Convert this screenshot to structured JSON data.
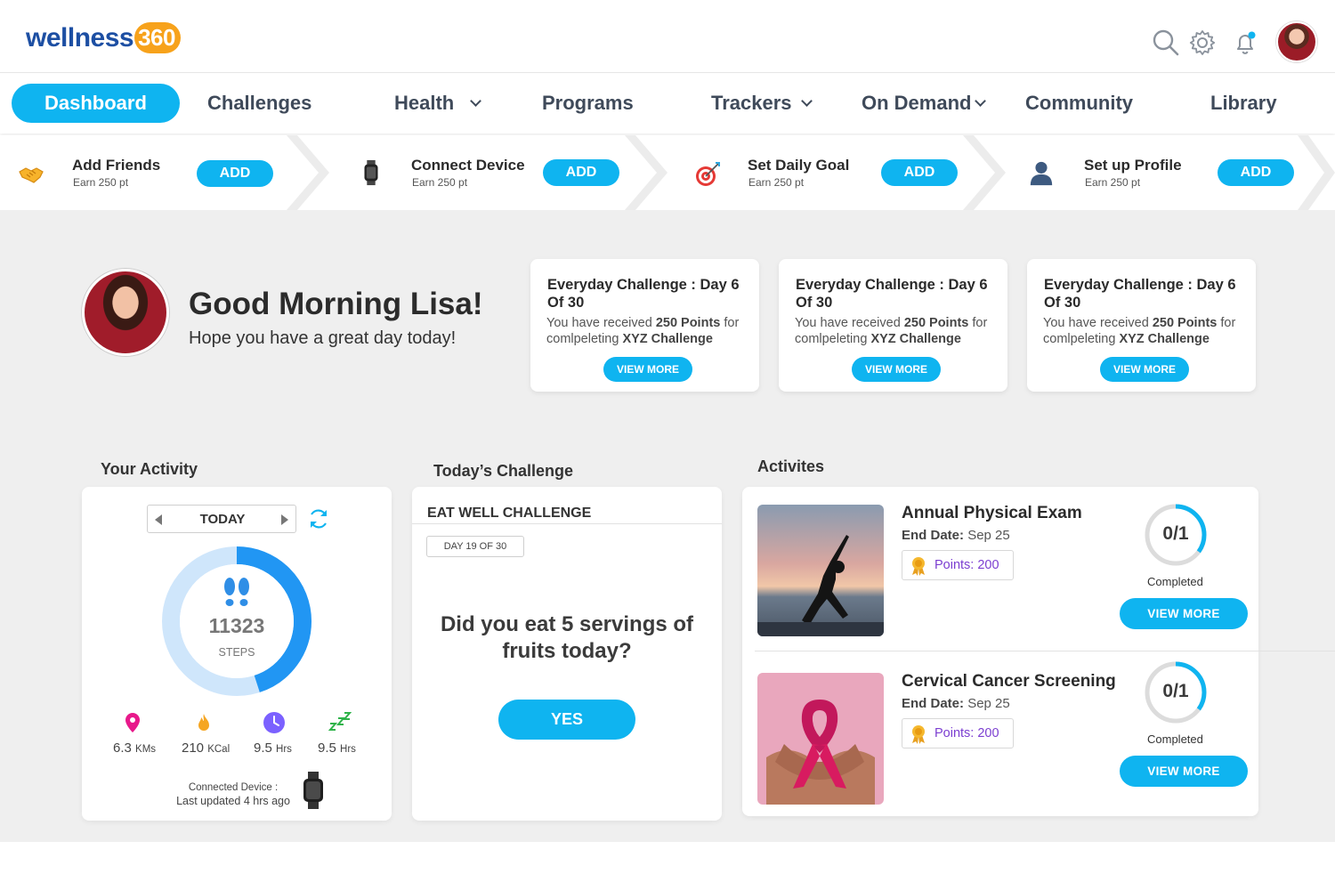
{
  "brand": {
    "name": "wellness",
    "num": "360"
  },
  "header": {
    "icons": [
      "search-icon",
      "settings-icon",
      "notification-icon"
    ]
  },
  "nav": {
    "items": [
      {
        "label": "Dashboard",
        "active": true
      },
      {
        "label": "Challenges"
      },
      {
        "label": "Health",
        "dropdown": true
      },
      {
        "label": "Programs"
      },
      {
        "label": "Trackers",
        "dropdown": true
      },
      {
        "label": "On Demand",
        "dropdown": true
      },
      {
        "label": "Community"
      },
      {
        "label": "Library"
      }
    ]
  },
  "steps": [
    {
      "title": "Add Friends",
      "sub": "Earn 250 pt",
      "button": "ADD",
      "icon": "handshake-icon"
    },
    {
      "title": "Connect Device",
      "sub": "Earn 250 pt",
      "button": "ADD",
      "icon": "smartwatch-icon"
    },
    {
      "title": "Set Daily Goal",
      "sub": "Earn 250 pt",
      "button": "ADD",
      "icon": "target-icon"
    },
    {
      "title": "Set up Profile",
      "sub": "Earn 250 pt",
      "button": "ADD",
      "icon": "user-icon"
    }
  ],
  "greeting": {
    "title": "Good Morning Lisa!",
    "sub": "Hope you have a great day today!"
  },
  "challenges": [
    {
      "title": "Everyday Challenge : Day 6 Of 30",
      "text_pre": "You have received ",
      "points": "250 Points",
      "text_mid": " for comlpeleting ",
      "challenge": "XYZ Challenge",
      "button": "VIEW MORE"
    },
    {
      "title": "Everyday Challenge : Day 6 Of 30",
      "text_pre": "You have received ",
      "points": "250 Points",
      "text_mid": " for comlpeleting ",
      "challenge": "XYZ Challenge",
      "button": "VIEW MORE"
    },
    {
      "title": "Everyday Challenge : Day 6 Of 30",
      "text_pre": "You have received ",
      "points": "250 Points",
      "text_mid": " for comlpeleting ",
      "challenge": "XYZ Challenge",
      "button": "VIEW MORE"
    }
  ],
  "activity": {
    "section_title": "Your Activity",
    "period": "TODAY",
    "steps": "11323",
    "steps_label": "STEPS",
    "steps_progress": 0.45,
    "stats": [
      {
        "value": "6.3",
        "unit": "KMs",
        "icon": "location-pin-icon",
        "color": "#e8198b"
      },
      {
        "value": "210",
        "unit": "KCal",
        "icon": "flame-icon",
        "color": "#f5a623"
      },
      {
        "value": "9.5",
        "unit": "Hrs",
        "icon": "clock-icon",
        "color": "#7b61ff"
      },
      {
        "value": "9.5",
        "unit": "Hrs",
        "icon": "sleep-icon",
        "color": "#2fb34a"
      }
    ],
    "connected_label": "Connected Device :",
    "last_updated": "Last updated 4 hrs ago"
  },
  "today_challenge": {
    "section_title": "Today’s Challenge",
    "name": "EAT WELL CHALLENGE",
    "day": "DAY 19 OF 30",
    "question": "Did you eat 5 servings of fruits today?",
    "button": "YES"
  },
  "activities": {
    "section_title": "Activites",
    "items": [
      {
        "title": "Annual Physical Exam",
        "date_label": "End Date:",
        "date": "Sep 25",
        "points": "Points: 200",
        "progress": "0/1",
        "progress_fraction": 0.35,
        "status": "Completed",
        "button": "VIEW MORE",
        "image": "yoga-silhouette"
      },
      {
        "title": "Cervical Cancer Screening",
        "date_label": "End Date:",
        "date": "Sep 25",
        "points": "Points: 200",
        "progress": "0/1",
        "progress_fraction": 0.35,
        "status": "Completed",
        "button": "VIEW MORE",
        "image": "pink-ribbon"
      }
    ]
  },
  "colors": {
    "accent": "#0fb4f0",
    "brand": "#1d4fa3",
    "brand_orange": "#f7a21b",
    "ring": "#2196f3",
    "ring_track": "#cfe6fb",
    "points_text": "#7c3fd1"
  }
}
